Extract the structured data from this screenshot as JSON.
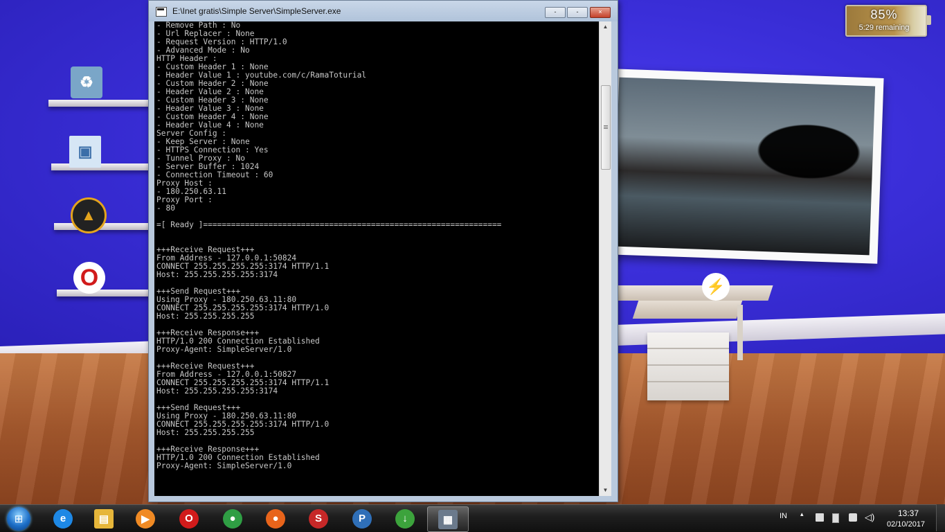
{
  "window": {
    "title": "E:\\Inet gratis\\Simple Server\\SimpleServer.exe",
    "minimize_label": "-",
    "maximize_label": "-",
    "close_label": "×"
  },
  "console": {
    "lines": [
      "- Remove Path : No",
      "- Url Replacer : None",
      "- Request Version : HTTP/1.0",
      "- Advanced Mode : No",
      "HTTP Header :",
      "- Custom Header 1 : None",
      "- Header Value 1 : youtube.com/c/RamaToturial",
      "- Custom Header 2 : None",
      "- Header Value 2 : None",
      "- Custom Header 3 : None",
      "- Header Value 3 : None",
      "- Custom Header 4 : None",
      "- Header Value 4 : None",
      "Server Config :",
      "- Keep Server : None",
      "- HTTPS Connection : Yes",
      "- Tunnel Proxy : No",
      "- Server Buffer : 1024",
      "- Connection Timeout : 60",
      "Proxy Host :",
      "- 180.250.63.11",
      "Proxy Port :",
      "- 80",
      "",
      "=[ Ready ]================================================================",
      "",
      "",
      "+++Receive Request+++",
      "From Address - 127.0.0.1:50824",
      "CONNECT 255.255.255.255:3174 HTTP/1.1",
      "Host: 255.255.255.255:3174",
      "",
      "+++Send Request+++",
      "Using Proxy - 180.250.63.11:80",
      "CONNECT 255.255.255.255:3174 HTTP/1.0",
      "Host: 255.255.255.255",
      "",
      "+++Receive Response+++",
      "HTTP/1.0 200 Connection Established",
      "Proxy-Agent: SimpleServer/1.0",
      "",
      "+++Receive Request+++",
      "From Address - 127.0.0.1:50827",
      "CONNECT 255.255.255.255:3174 HTTP/1.1",
      "Host: 255.255.255.255:3174",
      "",
      "+++Send Request+++",
      "Using Proxy - 180.250.63.11:80",
      "CONNECT 255.255.255.255:3174 HTTP/1.0",
      "Host: 255.255.255.255",
      "",
      "+++Receive Response+++",
      "HTTP/1.0 200 Connection Established",
      "Proxy-Agent: SimpleServer/1.0"
    ]
  },
  "battery": {
    "percent_label": "85%",
    "remaining_label": "5:29 remaining",
    "level": 0.85
  },
  "taskbar": {
    "items": [
      {
        "name": "taskbar-internet-explorer",
        "icon": "internet-explorer-icon",
        "glyph": "e",
        "color": "#1e88e5"
      },
      {
        "name": "taskbar-file-explorer",
        "icon": "folder-icon",
        "glyph": "▤",
        "color": "#e6b63a"
      },
      {
        "name": "taskbar-media-player",
        "icon": "media-player-icon",
        "glyph": "▶",
        "color": "#f08a24"
      },
      {
        "name": "taskbar-opera",
        "icon": "opera-icon",
        "glyph": "O",
        "color": "#d11b1b"
      },
      {
        "name": "taskbar-chrome",
        "icon": "chrome-icon",
        "glyph": "●",
        "color": "#2f9e44"
      },
      {
        "name": "taskbar-firefox",
        "icon": "firefox-icon",
        "glyph": "●",
        "color": "#e8641b"
      },
      {
        "name": "taskbar-simple-server",
        "icon": "simple-server-icon",
        "glyph": "S",
        "color": "#c62828"
      },
      {
        "name": "taskbar-network-app",
        "icon": "network-icon",
        "glyph": "P",
        "color": "#2f6fb8"
      },
      {
        "name": "taskbar-download-manager",
        "icon": "download-manager-icon",
        "glyph": "↓",
        "color": "#3ca33c"
      },
      {
        "name": "taskbar-console-window",
        "icon": "console-icon",
        "glyph": "▦",
        "color": "#6b7a8c"
      }
    ],
    "language": "IN",
    "time": "13:37",
    "date": "02/10/2017"
  },
  "desktop": {
    "icons": [
      {
        "name": "recycle-bin-icon",
        "glyph": "♻",
        "color": "#8fb8d8"
      },
      {
        "name": "control-panel-icon",
        "glyph": "▣",
        "color": "#d6e6f5"
      },
      {
        "name": "aimp-icon",
        "glyph": "▲",
        "color": "#e4a41d"
      },
      {
        "name": "opera-desktop-icon",
        "glyph": "O",
        "color": "#d11b1b"
      },
      {
        "name": "simple-server-desktop-icon",
        "glyph": "⚡",
        "color": "#d11b1b"
      }
    ]
  }
}
